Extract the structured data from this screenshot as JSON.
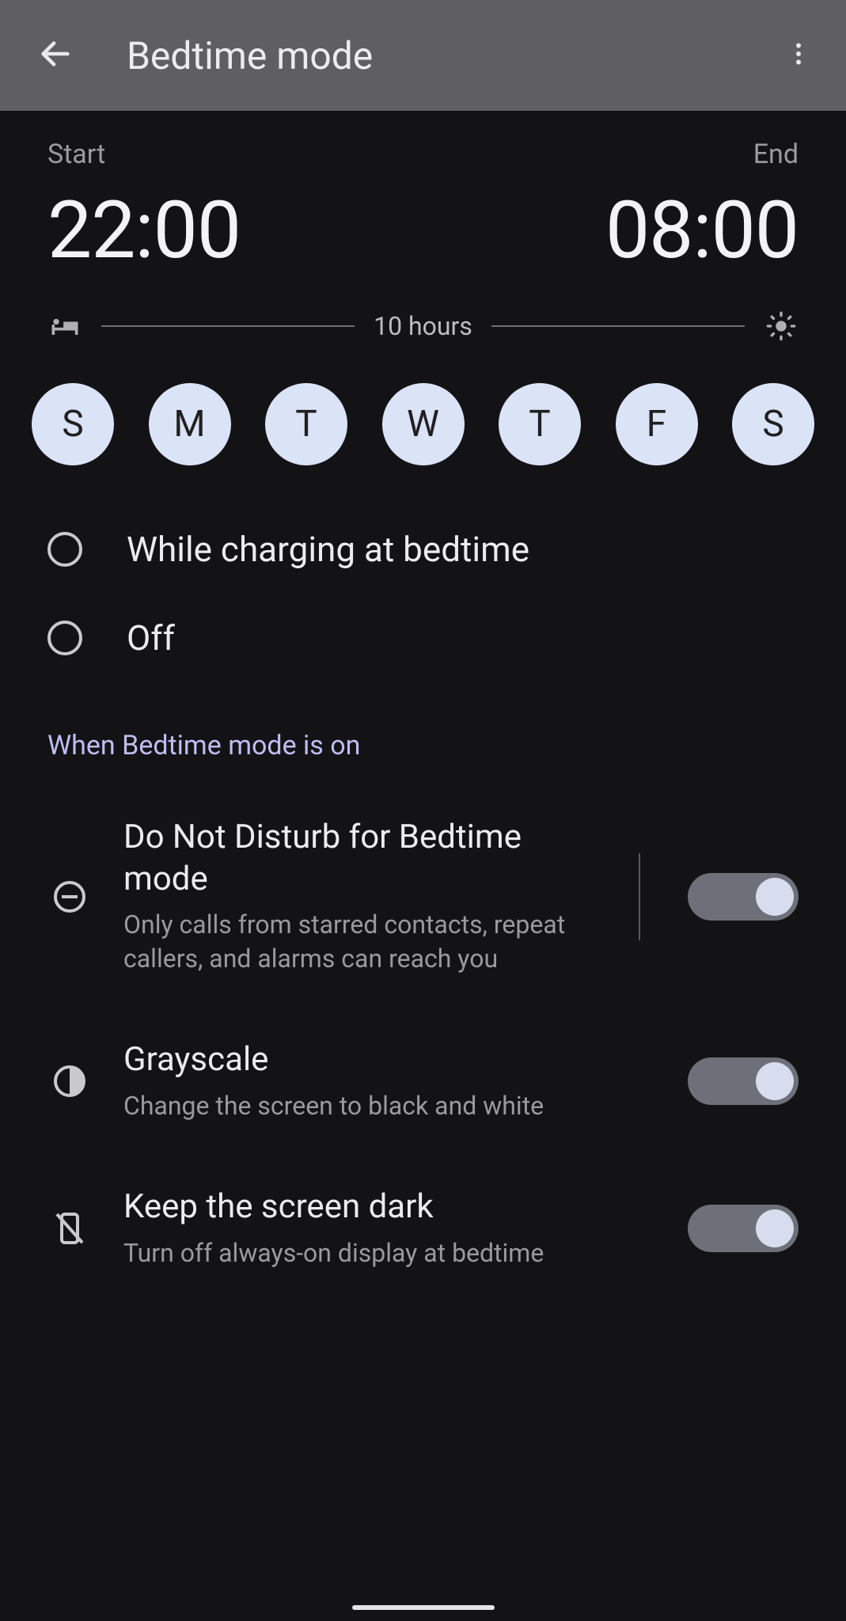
{
  "header": {
    "title": "Bedtime mode"
  },
  "times": {
    "start_label": "Start",
    "start_value": "22:00",
    "end_label": "End",
    "end_value": "08:00",
    "duration": "10 hours"
  },
  "days": [
    "S",
    "M",
    "T",
    "W",
    "T",
    "F",
    "S"
  ],
  "radios": {
    "charging": "While charging at bedtime",
    "off": "Off"
  },
  "section": "When Bedtime mode is on",
  "settings": {
    "dnd": {
      "title": "Do Not Disturb for Bedtime mode",
      "desc": "Only calls from starred contacts, repeat callers, and alarms can reach you"
    },
    "grayscale": {
      "title": "Grayscale",
      "desc": "Change the screen to black and white"
    },
    "dark": {
      "title": "Keep the screen dark",
      "desc": "Turn off always-on display at bedtime"
    }
  }
}
